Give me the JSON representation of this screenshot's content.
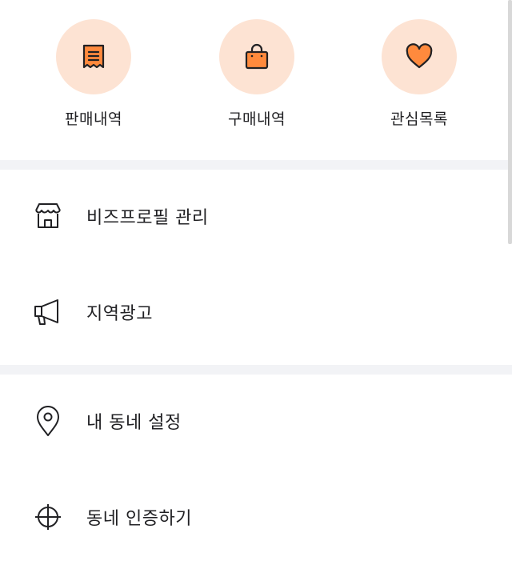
{
  "quick_menu": [
    {
      "label": "판매내역",
      "icon": "receipt-icon"
    },
    {
      "label": "구매내역",
      "icon": "shopping-bag-icon"
    },
    {
      "label": "관심목록",
      "icon": "heart-icon"
    }
  ],
  "menu_section_1": [
    {
      "label": "비즈프로필 관리",
      "icon": "store-icon"
    },
    {
      "label": "지역광고",
      "icon": "megaphone-icon"
    }
  ],
  "menu_section_2": [
    {
      "label": "내 동네 설정",
      "icon": "location-pin-icon"
    },
    {
      "label": "동네 인증하기",
      "icon": "target-icon"
    }
  ],
  "colors": {
    "accent": "#ff8a3d",
    "accent_light": "#fde3d3",
    "divider": "#f2f3f6",
    "text": "#212124"
  }
}
